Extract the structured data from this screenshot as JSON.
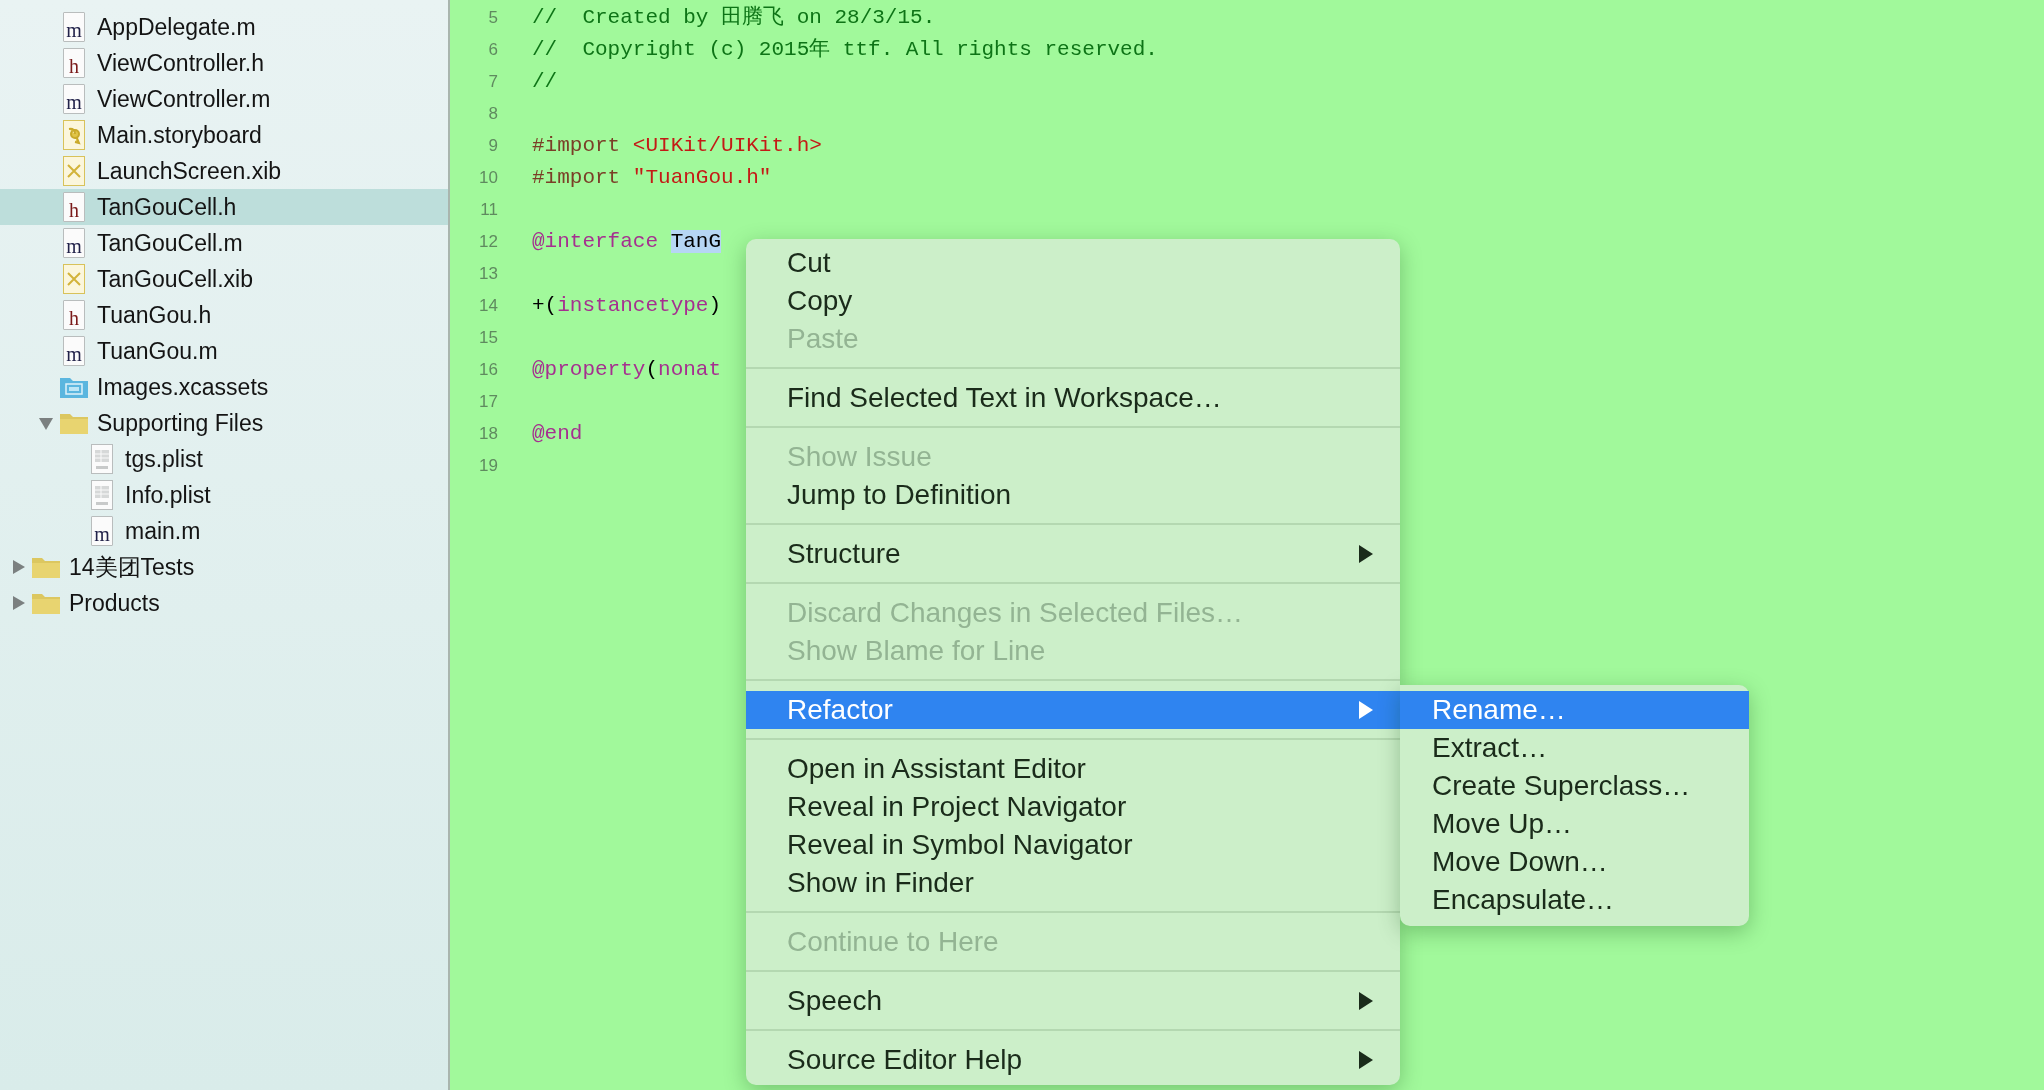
{
  "navigator": {
    "group_contents": [
      {
        "name": "AppDelegate.m",
        "kind": "source",
        "icon_letter": "m",
        "selected": false
      },
      {
        "name": "ViewController.h",
        "kind": "source",
        "icon_letter": "h",
        "selected": false
      },
      {
        "name": "ViewController.m",
        "kind": "source",
        "icon_letter": "m",
        "selected": false
      },
      {
        "name": "Main.storyboard",
        "kind": "storyboard",
        "selected": false
      },
      {
        "name": "LaunchScreen.xib",
        "kind": "xib",
        "selected": false
      },
      {
        "name": "TanGouCell.h",
        "kind": "source",
        "icon_letter": "h",
        "selected": true
      },
      {
        "name": "TanGouCell.m",
        "kind": "source",
        "icon_letter": "m",
        "selected": false
      },
      {
        "name": "TanGouCell.xib",
        "kind": "xib",
        "selected": false
      },
      {
        "name": "TuanGou.h",
        "kind": "source",
        "icon_letter": "h",
        "selected": false
      },
      {
        "name": "TuanGou.m",
        "kind": "source",
        "icon_letter": "m",
        "selected": false
      },
      {
        "name": "Images.xcassets",
        "kind": "assets",
        "selected": false
      },
      {
        "name": "Supporting Files",
        "kind": "folder",
        "expanded": true,
        "selected": false,
        "children": [
          {
            "name": "tgs.plist",
            "kind": "plist",
            "selected": false
          },
          {
            "name": "Info.plist",
            "kind": "plist",
            "selected": false
          },
          {
            "name": "main.m",
            "kind": "source",
            "icon_letter": "m",
            "selected": false
          }
        ]
      }
    ],
    "items": [
      {
        "name": "14美团Tests",
        "kind": "folder",
        "expanded": false,
        "selected": false
      },
      {
        "name": "Products",
        "kind": "folder",
        "expanded": false,
        "selected": false
      }
    ]
  },
  "editor": {
    "lines": [
      {
        "number": "5",
        "tokens": [
          {
            "kind": "comment",
            "text": "//  Created by 田腾飞 on 28/3/15."
          }
        ]
      },
      {
        "number": "6",
        "tokens": [
          {
            "kind": "comment",
            "text": "//  Copyright (c) 2015年 ttf. All rights reserved."
          }
        ]
      },
      {
        "number": "7",
        "tokens": [
          {
            "kind": "comment",
            "text": "//"
          }
        ]
      },
      {
        "number": "8"
      },
      {
        "number": "9",
        "tokens": [
          {
            "kind": "preproc",
            "text": "#import "
          },
          {
            "kind": "string",
            "text": "<UIKit/UIKit.h>"
          }
        ]
      },
      {
        "number": "10",
        "tokens": [
          {
            "kind": "preproc",
            "text": "#import "
          },
          {
            "kind": "string",
            "text": "\"TuanGou.h\""
          }
        ]
      },
      {
        "number": "11"
      },
      {
        "number": "12",
        "tokens": [
          {
            "kind": "keyword",
            "text": "@interface "
          },
          {
            "kind": "selected",
            "text": "TanG"
          }
        ]
      },
      {
        "number": "13"
      },
      {
        "number": "14",
        "tokens": [
          {
            "kind": "plain",
            "text": "+("
          },
          {
            "kind": "keyword",
            "text": "instancetype"
          },
          {
            "kind": "plain",
            "text": ")"
          }
        ]
      },
      {
        "number": "15"
      },
      {
        "number": "16",
        "tokens": [
          {
            "kind": "keyword",
            "text": "@property"
          },
          {
            "kind": "plain",
            "text": "("
          },
          {
            "kind": "keyword",
            "text": "nonat"
          }
        ]
      },
      {
        "number": "17"
      },
      {
        "number": "18",
        "tokens": [
          {
            "kind": "keyword",
            "text": "@end"
          }
        ]
      },
      {
        "number": "19"
      }
    ]
  },
  "context_menu": {
    "sections": [
      {
        "items": [
          {
            "label": "Cut",
            "disabled": false,
            "selected": false
          },
          {
            "label": "Copy",
            "disabled": false,
            "selected": false
          },
          {
            "label": "Paste",
            "disabled": true,
            "selected": false
          }
        ]
      },
      {
        "items": [
          {
            "label": "Find Selected Text in Workspace…",
            "disabled": false,
            "selected": false
          }
        ]
      },
      {
        "items": [
          {
            "label": "Show Issue",
            "disabled": true,
            "selected": false
          },
          {
            "label": "Jump to Definition",
            "disabled": false,
            "selected": false
          }
        ]
      },
      {
        "items": [
          {
            "label": "Structure",
            "disabled": false,
            "selected": false,
            "has_submenu": true
          }
        ]
      },
      {
        "items": [
          {
            "label": "Discard Changes in Selected Files…",
            "disabled": true,
            "selected": false
          },
          {
            "label": "Show Blame for Line",
            "disabled": true,
            "selected": false
          }
        ]
      },
      {
        "items": [
          {
            "label": "Refactor",
            "disabled": false,
            "selected": true,
            "has_submenu": true,
            "submenu": [
              {
                "label": "Rename…",
                "selected": true
              },
              {
                "label": "Extract…",
                "selected": false
              },
              {
                "label": "Create Superclass…",
                "selected": false
              },
              {
                "label": "Move Up…",
                "selected": false
              },
              {
                "label": "Move Down…",
                "selected": false
              },
              {
                "label": "Encapsulate…",
                "selected": false
              }
            ]
          }
        ]
      },
      {
        "items": [
          {
            "label": "Open in Assistant Editor",
            "disabled": false,
            "selected": false
          },
          {
            "label": "Reveal in Project Navigator",
            "disabled": false,
            "selected": false
          },
          {
            "label": "Reveal in Symbol Navigator",
            "disabled": false,
            "selected": false
          },
          {
            "label": "Show in Finder",
            "disabled": false,
            "selected": false
          }
        ]
      },
      {
        "items": [
          {
            "label": "Continue to Here",
            "disabled": true,
            "selected": false
          }
        ]
      },
      {
        "items": [
          {
            "label": "Speech",
            "disabled": false,
            "selected": false,
            "has_submenu": true
          }
        ]
      },
      {
        "items": [
          {
            "label": "Source Editor Help",
            "disabled": false,
            "selected": false,
            "has_submenu": true
          }
        ]
      }
    ]
  }
}
